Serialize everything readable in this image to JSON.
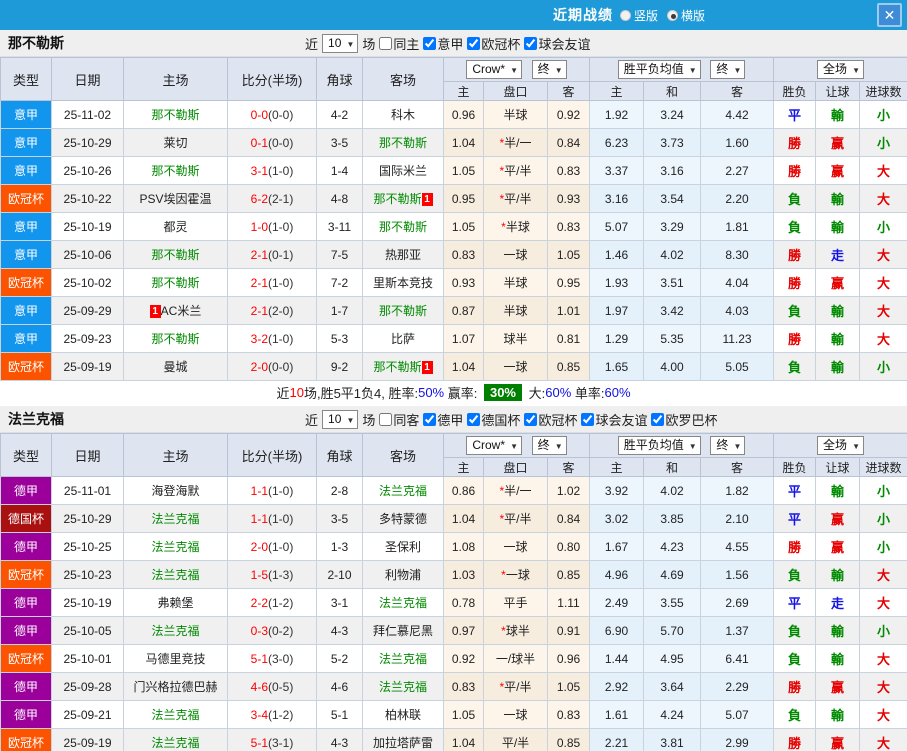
{
  "titlebar": {
    "title": "近期战绩",
    "radios": [
      {
        "label": "竖版",
        "selected": false
      },
      {
        "label": "横版",
        "selected": true
      }
    ],
    "close_glyph": "✕"
  },
  "table_header": {
    "cols": [
      "类型",
      "日期",
      "主场",
      "比分(半场)",
      "角球",
      "客场"
    ],
    "odds_group": {
      "bookmaker": "Crow*",
      "time": "终",
      "cols": [
        "主",
        "盘口",
        "客"
      ]
    },
    "avg_group": {
      "label": "胜平负均值",
      "time": "终",
      "cols": [
        "主",
        "和",
        "客"
      ]
    },
    "result_group": {
      "label": "全场",
      "cols": [
        "胜负",
        "让球",
        "进球数"
      ]
    }
  },
  "colors": {
    "topbar": "#1D9AD7",
    "league_colors": {
      "意甲": "#1295EC",
      "欧冠杯": "#FB5300",
      "德甲": "#9B009B",
      "德国杯": "#A91111"
    },
    "result_colors": {
      "勝": "#E60000",
      "負": "#008A00",
      "平": "#1414E6",
      "赢": "#E60000",
      "輸": "#008A00",
      "走": "#1414E6",
      "大": "#E60000",
      "小": "#008A00"
    },
    "team_highlight": "#008A00",
    "score_red": "#FF0000",
    "badge_red": "#FF0000",
    "summary_box": "#008000"
  },
  "teams": [
    {
      "name": "那不勒斯",
      "filter": {
        "near": "近",
        "count": "10",
        "games": "场",
        "same": {
          "label": "同主",
          "checked": false
        },
        "leagues": [
          {
            "label": "意甲",
            "checked": true
          },
          {
            "label": "欧冠杯",
            "checked": true
          },
          {
            "label": "球会友谊",
            "checked": true
          }
        ]
      },
      "rows": [
        {
          "league": "意甲",
          "date": "25-11-02",
          "home": {
            "name": "那不勒斯",
            "green": true
          },
          "score": "0-0",
          "half": "(0-0)",
          "corner": "4-2",
          "away": {
            "name": "科木",
            "green": false
          },
          "crow": [
            "0.96",
            "半球",
            "0.92"
          ],
          "avg": [
            "1.92",
            "3.24",
            "4.42"
          ],
          "result": [
            "平",
            "輸",
            "小"
          ]
        },
        {
          "league": "意甲",
          "date": "25-10-29",
          "home": {
            "name": "莱切",
            "green": false
          },
          "score": "0-1",
          "half": "(0-0)",
          "corner": "3-5",
          "away": {
            "name": "那不勒斯",
            "green": true
          },
          "crow": [
            "1.04",
            "*半/一",
            "0.84"
          ],
          "avg": [
            "6.23",
            "3.73",
            "1.60"
          ],
          "result": [
            "勝",
            "赢",
            "小"
          ]
        },
        {
          "league": "意甲",
          "date": "25-10-26",
          "home": {
            "name": "那不勒斯",
            "green": true
          },
          "score": "3-1",
          "half": "(1-0)",
          "corner": "1-4",
          "away": {
            "name": "国际米兰",
            "green": false
          },
          "crow": [
            "1.05",
            "*平/半",
            "0.83"
          ],
          "avg": [
            "3.37",
            "3.16",
            "2.27"
          ],
          "result": [
            "勝",
            "赢",
            "大"
          ]
        },
        {
          "league": "欧冠杯",
          "date": "25-10-22",
          "home": {
            "name": "PSV埃因霍温",
            "green": false
          },
          "score": "6-2",
          "half": "(2-1)",
          "corner": "4-8",
          "away": {
            "name": "那不勒斯",
            "green": true,
            "badge": "1",
            "badge_pos": "after"
          },
          "crow": [
            "0.95",
            "*平/半",
            "0.93"
          ],
          "avg": [
            "3.16",
            "3.54",
            "2.20"
          ],
          "result": [
            "負",
            "輸",
            "大"
          ]
        },
        {
          "league": "意甲",
          "date": "25-10-19",
          "home": {
            "name": "都灵",
            "green": false
          },
          "score": "1-0",
          "half": "(1-0)",
          "corner": "3-11",
          "away": {
            "name": "那不勒斯",
            "green": true
          },
          "crow": [
            "1.05",
            "*半球",
            "0.83"
          ],
          "avg": [
            "5.07",
            "3.29",
            "1.81"
          ],
          "result": [
            "負",
            "輸",
            "小"
          ]
        },
        {
          "league": "意甲",
          "date": "25-10-06",
          "home": {
            "name": "那不勒斯",
            "green": true
          },
          "score": "2-1",
          "half": "(0-1)",
          "corner": "7-5",
          "away": {
            "name": "热那亚",
            "green": false
          },
          "crow": [
            "0.83",
            "一球",
            "1.05"
          ],
          "avg": [
            "1.46",
            "4.02",
            "8.30"
          ],
          "result": [
            "勝",
            "走",
            "大"
          ]
        },
        {
          "league": "欧冠杯",
          "date": "25-10-02",
          "home": {
            "name": "那不勒斯",
            "green": true
          },
          "score": "2-1",
          "half": "(1-0)",
          "corner": "7-2",
          "away": {
            "name": "里斯本竞技",
            "green": false
          },
          "crow": [
            "0.93",
            "半球",
            "0.95"
          ],
          "avg": [
            "1.93",
            "3.51",
            "4.04"
          ],
          "result": [
            "勝",
            "赢",
            "大"
          ]
        },
        {
          "league": "意甲",
          "date": "25-09-29",
          "home": {
            "name": "AC米兰",
            "green": false,
            "badge": "1",
            "badge_pos": "before"
          },
          "score": "2-1",
          "half": "(2-0)",
          "corner": "1-7",
          "away": {
            "name": "那不勒斯",
            "green": true
          },
          "crow": [
            "0.87",
            "半球",
            "1.01"
          ],
          "avg": [
            "1.97",
            "3.42",
            "4.03"
          ],
          "result": [
            "負",
            "輸",
            "大"
          ]
        },
        {
          "league": "意甲",
          "date": "25-09-23",
          "home": {
            "name": "那不勒斯",
            "green": true
          },
          "score": "3-2",
          "half": "(1-0)",
          "corner": "5-3",
          "away": {
            "name": "比萨",
            "green": false
          },
          "crow": [
            "1.07",
            "球半",
            "0.81"
          ],
          "avg": [
            "1.29",
            "5.35",
            "11.23"
          ],
          "result": [
            "勝",
            "輸",
            "大"
          ]
        },
        {
          "league": "欧冠杯",
          "date": "25-09-19",
          "home": {
            "name": "曼城",
            "green": false
          },
          "score": "2-0",
          "half": "(0-0)",
          "corner": "9-2",
          "away": {
            "name": "那不勒斯",
            "green": true,
            "badge": "1",
            "badge_pos": "after"
          },
          "crow": [
            "1.04",
            "一球",
            "0.85"
          ],
          "avg": [
            "1.65",
            "4.00",
            "5.05"
          ],
          "result": [
            "負",
            "輸",
            "小"
          ]
        }
      ],
      "summary": {
        "segments": [
          {
            "text": "近",
            "style": "dark"
          },
          {
            "text": "10",
            "style": "red"
          },
          {
            "text": "场,胜5平1负4, 胜率:",
            "style": "dark"
          },
          {
            "text": "50%",
            "style": "blue"
          },
          {
            "text": " 赢率: ",
            "style": "dark"
          },
          {
            "text": "30%",
            "style": "greenbox"
          },
          {
            "text": " 大:",
            "style": "dark"
          },
          {
            "text": "60%",
            "style": "blue"
          },
          {
            "text": " 单率:",
            "style": "dark"
          },
          {
            "text": "60%",
            "style": "blue"
          }
        ]
      }
    },
    {
      "name": "法兰克福",
      "filter": {
        "near": "近",
        "count": "10",
        "games": "场",
        "same": {
          "label": "同客",
          "checked": false
        },
        "leagues": [
          {
            "label": "德甲",
            "checked": true
          },
          {
            "label": "德国杯",
            "checked": true
          },
          {
            "label": "欧冠杯",
            "checked": true
          },
          {
            "label": "球会友谊",
            "checked": true
          },
          {
            "label": "欧罗巴杯",
            "checked": true
          }
        ]
      },
      "rows": [
        {
          "league": "德甲",
          "date": "25-11-01",
          "home": {
            "name": "海登海默",
            "green": false
          },
          "score": "1-1",
          "half": "(1-0)",
          "corner": "2-8",
          "away": {
            "name": "法兰克福",
            "green": true
          },
          "crow": [
            "0.86",
            "*半/一",
            "1.02"
          ],
          "avg": [
            "3.92",
            "4.02",
            "1.82"
          ],
          "result": [
            "平",
            "輸",
            "小"
          ]
        },
        {
          "league": "德国杯",
          "date": "25-10-29",
          "home": {
            "name": "法兰克福",
            "green": true
          },
          "score": "1-1",
          "half": "(1-0)",
          "corner": "3-5",
          "away": {
            "name": "多特蒙德",
            "green": false
          },
          "crow": [
            "1.04",
            "*平/半",
            "0.84"
          ],
          "avg": [
            "3.02",
            "3.85",
            "2.10"
          ],
          "result": [
            "平",
            "赢",
            "小"
          ]
        },
        {
          "league": "德甲",
          "date": "25-10-25",
          "home": {
            "name": "法兰克福",
            "green": true
          },
          "score": "2-0",
          "half": "(1-0)",
          "corner": "1-3",
          "away": {
            "name": "圣保利",
            "green": false
          },
          "crow": [
            "1.08",
            "一球",
            "0.80"
          ],
          "avg": [
            "1.67",
            "4.23",
            "4.55"
          ],
          "result": [
            "勝",
            "赢",
            "小"
          ]
        },
        {
          "league": "欧冠杯",
          "date": "25-10-23",
          "home": {
            "name": "法兰克福",
            "green": true
          },
          "score": "1-5",
          "half": "(1-3)",
          "corner": "2-10",
          "away": {
            "name": "利物浦",
            "green": false
          },
          "crow": [
            "1.03",
            "*一球",
            "0.85"
          ],
          "avg": [
            "4.96",
            "4.69",
            "1.56"
          ],
          "result": [
            "負",
            "輸",
            "大"
          ]
        },
        {
          "league": "德甲",
          "date": "25-10-19",
          "home": {
            "name": "弗赖堡",
            "green": false
          },
          "score": "2-2",
          "half": "(1-2)",
          "corner": "3-1",
          "away": {
            "name": "法兰克福",
            "green": true
          },
          "crow": [
            "0.78",
            "平手",
            "1.11"
          ],
          "avg": [
            "2.49",
            "3.55",
            "2.69"
          ],
          "result": [
            "平",
            "走",
            "大"
          ]
        },
        {
          "league": "德甲",
          "date": "25-10-05",
          "home": {
            "name": "法兰克福",
            "green": true
          },
          "score": "0-3",
          "half": "(0-2)",
          "corner": "4-3",
          "away": {
            "name": "拜仁慕尼黑",
            "green": false
          },
          "crow": [
            "0.97",
            "*球半",
            "0.91"
          ],
          "avg": [
            "6.90",
            "5.70",
            "1.37"
          ],
          "result": [
            "負",
            "輸",
            "小"
          ]
        },
        {
          "league": "欧冠杯",
          "date": "25-10-01",
          "home": {
            "name": "马德里竞技",
            "green": false
          },
          "score": "5-1",
          "half": "(3-0)",
          "corner": "5-2",
          "away": {
            "name": "法兰克福",
            "green": true
          },
          "crow": [
            "0.92",
            "一/球半",
            "0.96"
          ],
          "avg": [
            "1.44",
            "4.95",
            "6.41"
          ],
          "result": [
            "負",
            "輸",
            "大"
          ]
        },
        {
          "league": "德甲",
          "date": "25-09-28",
          "home": {
            "name": "门兴格拉德巴赫",
            "green": false
          },
          "score": "4-6",
          "half": "(0-5)",
          "corner": "4-6",
          "away": {
            "name": "法兰克福",
            "green": true
          },
          "crow": [
            "0.83",
            "*平/半",
            "1.05"
          ],
          "avg": [
            "2.92",
            "3.64",
            "2.29"
          ],
          "result": [
            "勝",
            "赢",
            "大"
          ]
        },
        {
          "league": "德甲",
          "date": "25-09-21",
          "home": {
            "name": "法兰克福",
            "green": true
          },
          "score": "3-4",
          "half": "(1-2)",
          "corner": "5-1",
          "away": {
            "name": "柏林联",
            "green": false
          },
          "crow": [
            "1.05",
            "一球",
            "0.83"
          ],
          "avg": [
            "1.61",
            "4.24",
            "5.07"
          ],
          "result": [
            "負",
            "輸",
            "大"
          ]
        },
        {
          "league": "欧冠杯",
          "date": "25-09-19",
          "home": {
            "name": "法兰克福",
            "green": true
          },
          "score": "5-1",
          "half": "(3-1)",
          "corner": "4-3",
          "away": {
            "name": "加拉塔萨雷",
            "green": false
          },
          "crow": [
            "1.04",
            "平/半",
            "0.85"
          ],
          "avg": [
            "2.21",
            "3.81",
            "2.99"
          ],
          "result": [
            "勝",
            "赢",
            "大"
          ]
        }
      ]
    }
  ]
}
